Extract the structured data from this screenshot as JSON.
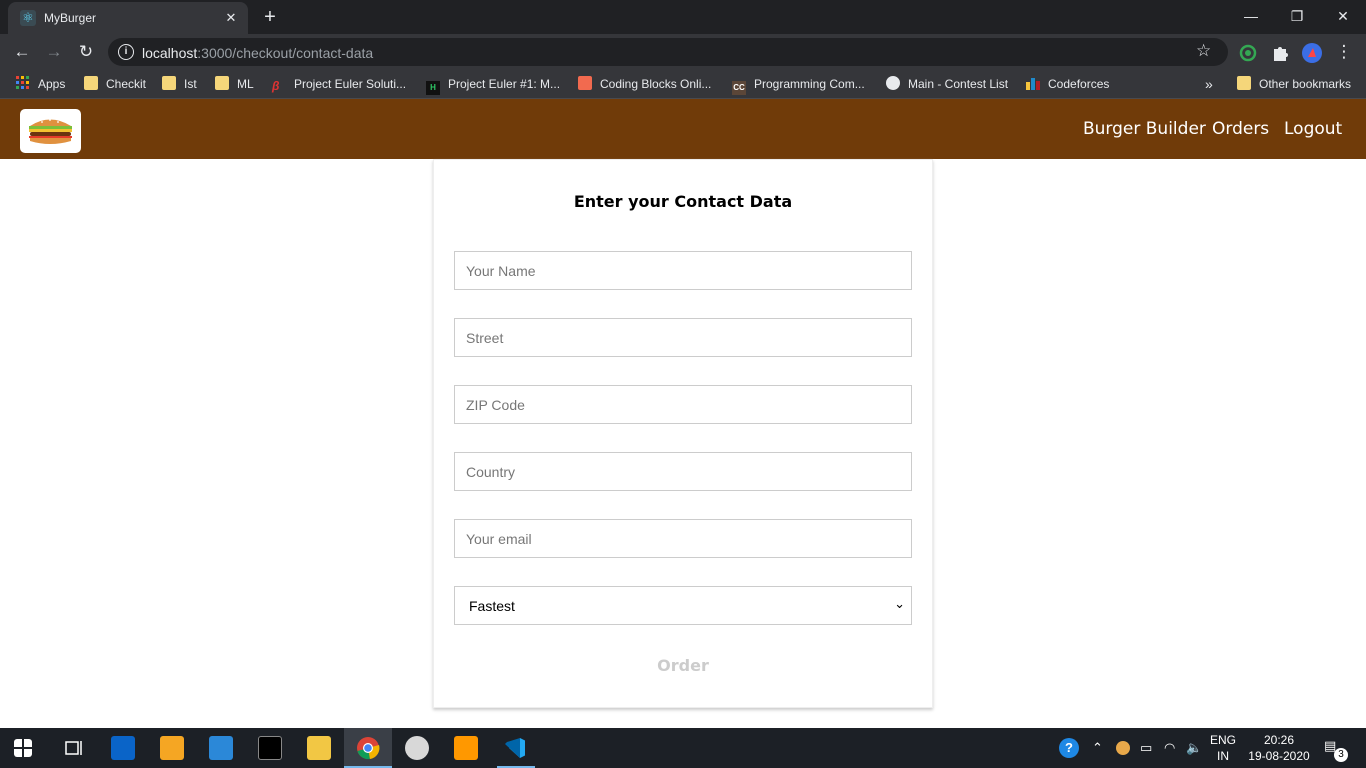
{
  "browser": {
    "tab_title": "MyBurger",
    "url_host": "localhost",
    "url_path": ":3000/checkout/contact-data",
    "bookmarks": [
      {
        "label": "Apps"
      },
      {
        "label": "Checkit"
      },
      {
        "label": "Ist"
      },
      {
        "label": "ML"
      },
      {
        "label": "Project Euler Soluti..."
      },
      {
        "label": "Project Euler #1: M..."
      },
      {
        "label": "Coding Blocks Onli..."
      },
      {
        "label": "Programming Com..."
      },
      {
        "label": "Main - Contest List"
      },
      {
        "label": "Codeforces"
      }
    ],
    "overflow_label": "»",
    "other_bookmarks": "Other bookmarks"
  },
  "header": {
    "nav": [
      "Burger Builder",
      "Orders",
      "Logout"
    ]
  },
  "form": {
    "title": "Enter your Contact Data",
    "fields": [
      {
        "placeholder": "Your Name"
      },
      {
        "placeholder": "Street"
      },
      {
        "placeholder": "ZIP Code"
      },
      {
        "placeholder": "Country"
      },
      {
        "placeholder": "Your email"
      }
    ],
    "delivery_method": "Fastest",
    "order_label": "Order"
  },
  "taskbar": {
    "lang_top": "ENG",
    "lang_bottom": "IN",
    "time": "20:26",
    "date": "19-08-2020",
    "notifications": "3"
  },
  "colors": {
    "header": "#703b09",
    "order_disabled": "#cccccc"
  }
}
